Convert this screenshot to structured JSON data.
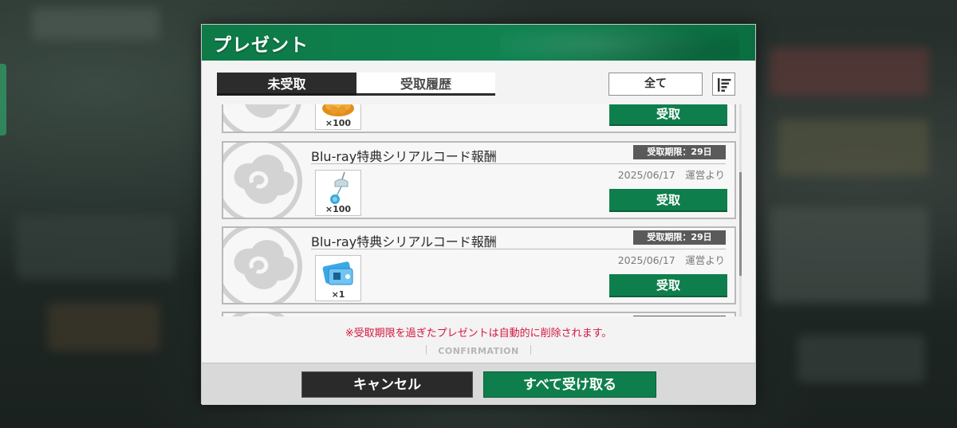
{
  "dialog": {
    "title": "プレゼント"
  },
  "tabs": [
    {
      "label": "未受取",
      "active": true
    },
    {
      "label": "受取履歴",
      "active": false
    }
  ],
  "filter": {
    "label": "全て"
  },
  "items": [
    {
      "qty": "×100",
      "receive_label": "受取",
      "icon": "gold-nugget-pile-icon"
    },
    {
      "title": "Blu-ray特典シリアルコード報酬",
      "deadline": "受取期限：29日",
      "date": "2025/06/17　運営より",
      "qty": "×100",
      "receive_label": "受取",
      "icon": "wind-chime-icon"
    },
    {
      "title": "Blu-ray特典シリアルコード報酬",
      "deadline": "受取期限：29日",
      "date": "2025/06/17　運営より",
      "qty": "×1",
      "receive_label": "受取",
      "icon": "ticket-icon"
    }
  ],
  "notice": "※受取期限を過ぎたプレゼントは自動的に削除されます。",
  "confirmation_label": "CONFIRMATION",
  "footer": {
    "cancel_label": "キャンセル",
    "receive_all_label": "すべて受け取る"
  },
  "colors": {
    "brand_green": "#0e7f4c",
    "dark": "#2c2c2c",
    "notice_red": "#d6173f"
  }
}
